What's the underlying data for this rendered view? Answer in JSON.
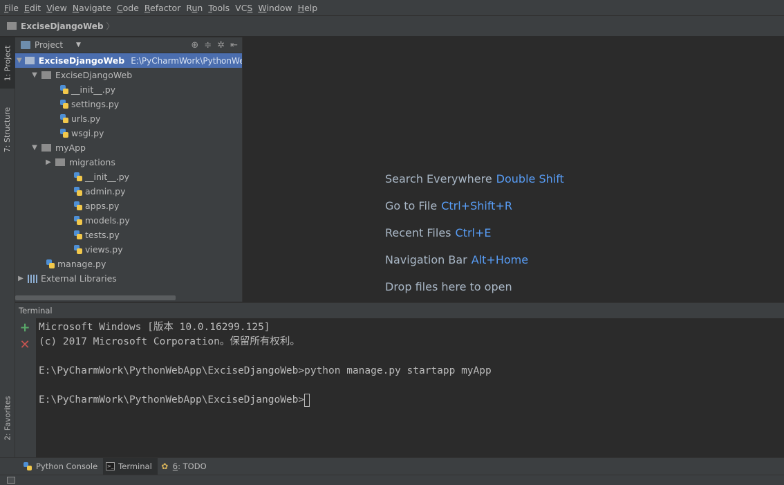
{
  "menu": [
    {
      "pre": "",
      "u": "F",
      "post": "ile"
    },
    {
      "pre": "",
      "u": "E",
      "post": "dit"
    },
    {
      "pre": "",
      "u": "V",
      "post": "iew"
    },
    {
      "pre": "",
      "u": "N",
      "post": "avigate"
    },
    {
      "pre": "",
      "u": "C",
      "post": "ode"
    },
    {
      "pre": "",
      "u": "R",
      "post": "efactor"
    },
    {
      "pre": "R",
      "u": "u",
      "post": "n"
    },
    {
      "pre": "",
      "u": "T",
      "post": "ools"
    },
    {
      "pre": "VC",
      "u": "S",
      "post": ""
    },
    {
      "pre": "",
      "u": "W",
      "post": "indow"
    },
    {
      "pre": "",
      "u": "H",
      "post": "elp"
    }
  ],
  "breadcrumb": {
    "project": "ExciseDjangoWeb"
  },
  "left_strip": {
    "project_tab": "1: Project",
    "structure_tab": "7: Structure",
    "favorites_tab": "2: Favorites"
  },
  "project_panel": {
    "title": "Project",
    "tree": {
      "root": {
        "label": "ExciseDjangoWeb",
        "path": "E:\\PyCharmWork\\PythonWebApp\\ExciseDjangoWeb"
      },
      "pkg1": {
        "label": "ExciseDjangoWeb"
      },
      "pkg1_files": [
        "__init__.py",
        "settings.py",
        "urls.py",
        "wsgi.py"
      ],
      "app": {
        "label": "myApp"
      },
      "migrations": {
        "label": "migrations"
      },
      "app_files": [
        "__init__.py",
        "admin.py",
        "apps.py",
        "models.py",
        "tests.py",
        "views.py"
      ],
      "manage": {
        "label": "manage.py"
      },
      "libs": {
        "label": "External Libraries"
      }
    }
  },
  "editor_hints": [
    {
      "text": "Search Everywhere",
      "key": "Double Shift"
    },
    {
      "text": "Go to File",
      "key": "Ctrl+Shift+R"
    },
    {
      "text": "Recent Files",
      "key": "Ctrl+E"
    },
    {
      "text": "Navigation Bar",
      "key": "Alt+Home"
    },
    {
      "text": "Drop files here to open",
      "key": ""
    }
  ],
  "terminal": {
    "title": "Terminal",
    "lines": [
      "Microsoft Windows [版本 10.0.16299.125]",
      "(c) 2017 Microsoft Corporation。保留所有权利。",
      "",
      "E:\\PyCharmWork\\PythonWebApp\\ExciseDjangoWeb>python manage.py startapp myApp",
      "",
      "E:\\PyCharmWork\\PythonWebApp\\ExciseDjangoWeb>"
    ]
  },
  "bottom_tabs": {
    "python_console": "Python Console",
    "terminal": "Terminal",
    "todo_num": "6",
    "todo_rest": ": TODO"
  },
  "colors": {
    "accent_key": "#589df6",
    "selection": "#4b6eaf",
    "add": "#59a869",
    "close": "#c75450"
  }
}
